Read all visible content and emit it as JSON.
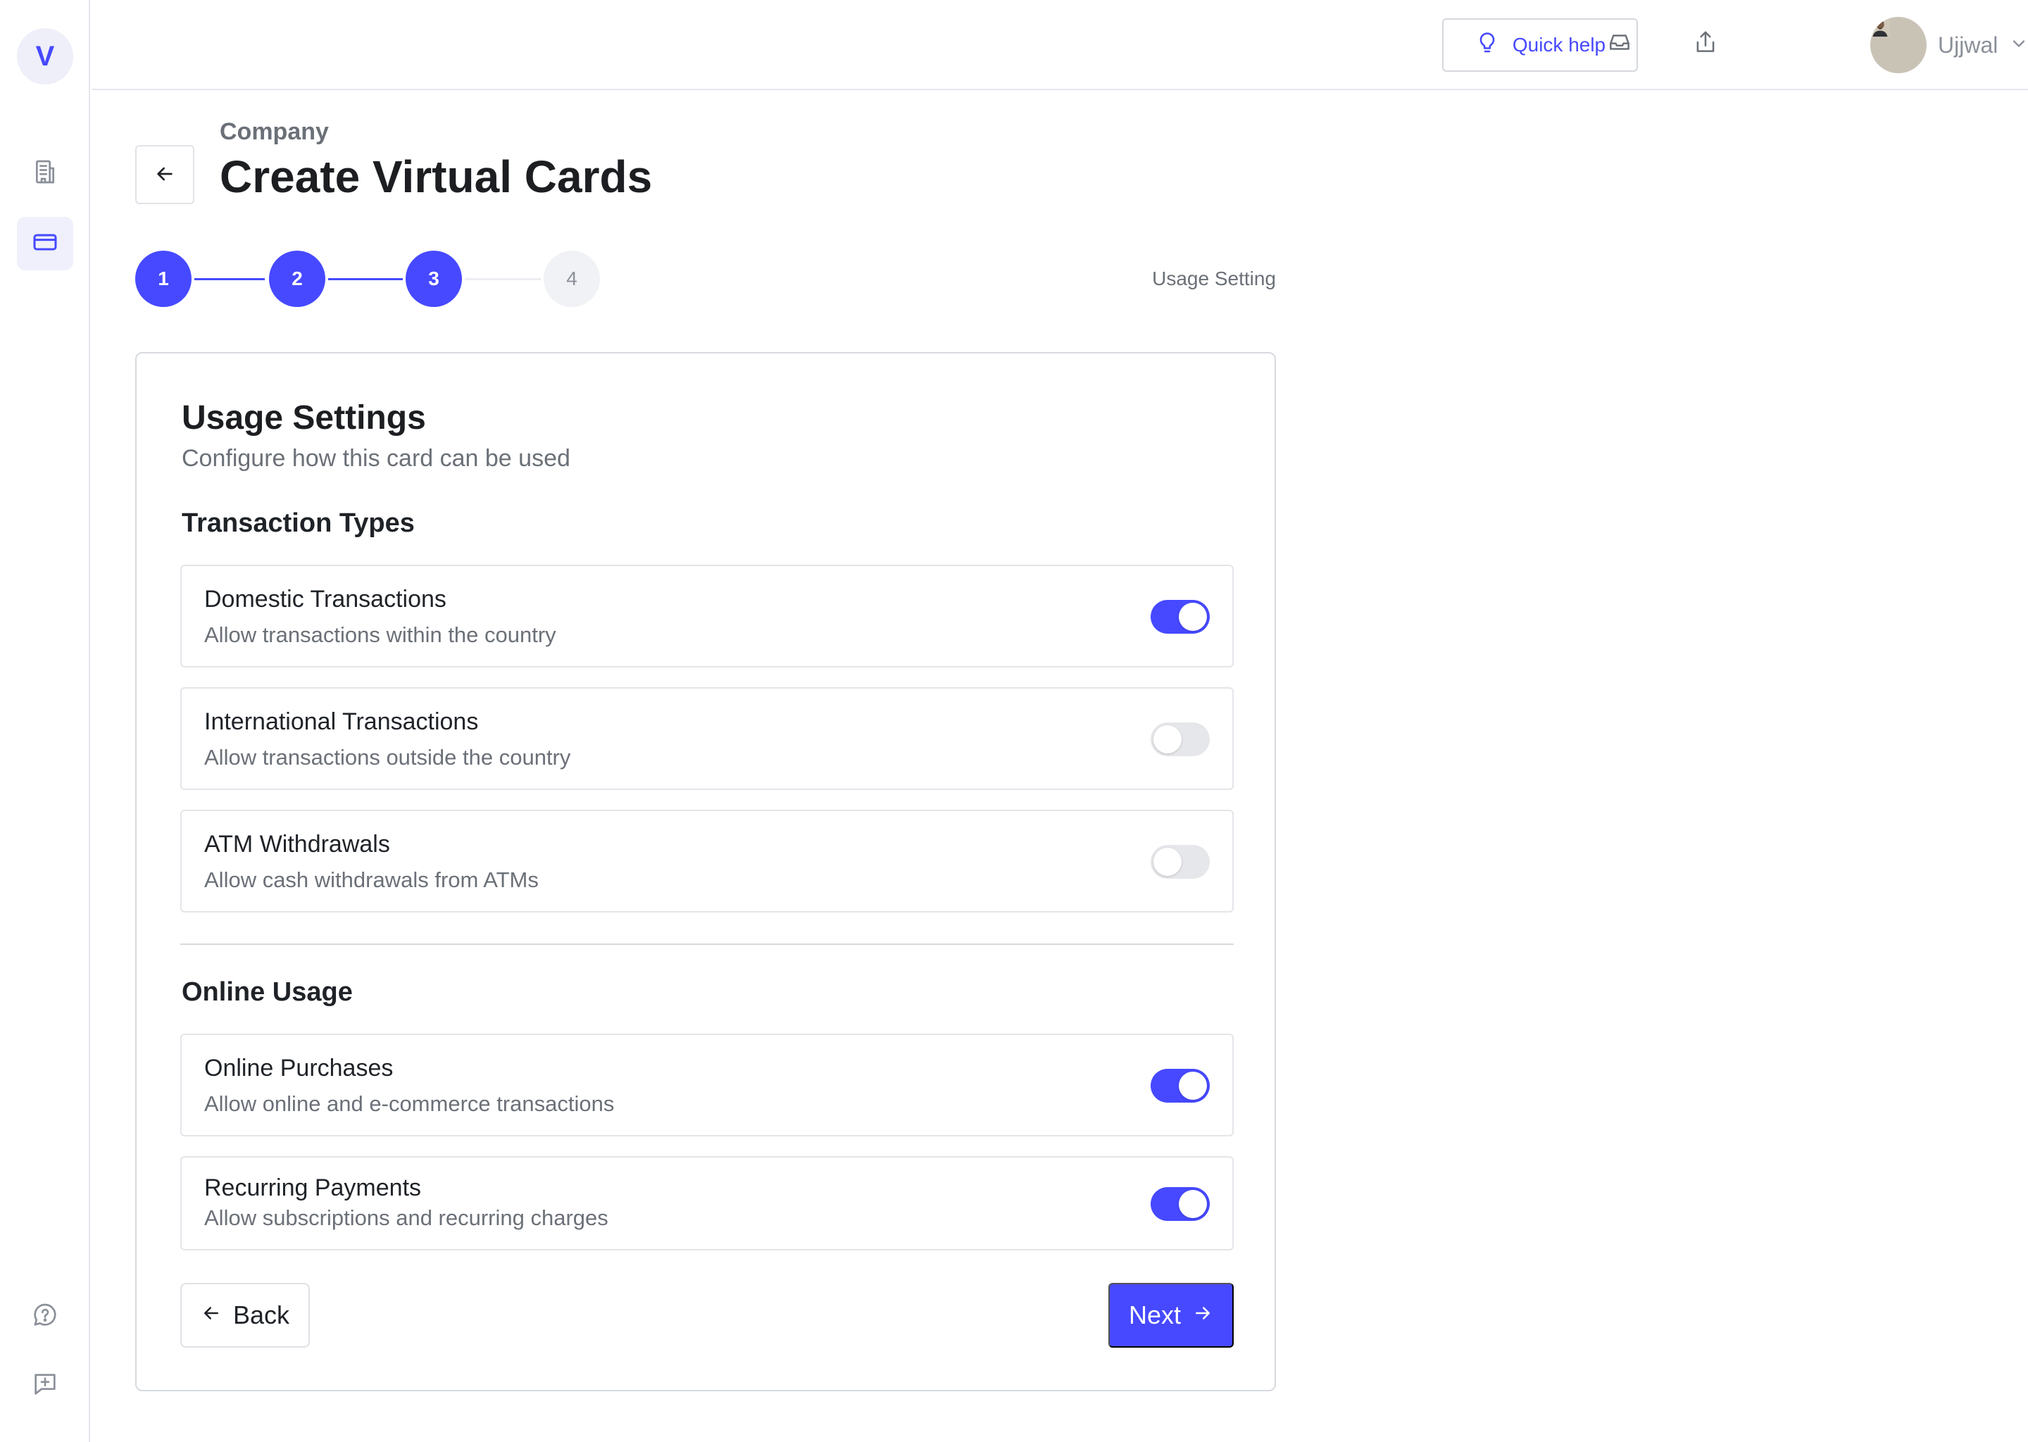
{
  "sidebar": {
    "logo_letter": "V",
    "icons": [
      "building-icon",
      "credit-card-icon",
      "help-chat-icon",
      "feedback-icon"
    ]
  },
  "topbar": {
    "quick_help_label": "Quick help",
    "user_name": "Ujjwal"
  },
  "header": {
    "breadcrumb": "Company",
    "title": "Create Virtual Cards"
  },
  "stepper": {
    "steps": [
      "1",
      "2",
      "3",
      "4"
    ],
    "completed_steps": 3,
    "current_label": "Usage Setting"
  },
  "card": {
    "title": "Usage Settings",
    "subtitle": "Configure how this card can be used",
    "sections": [
      {
        "heading": "Transaction Types",
        "options": [
          {
            "title": "Domestic Transactions",
            "description": "Allow transactions within the country",
            "enabled": true
          },
          {
            "title": "International Transactions",
            "description": "Allow transactions outside the country",
            "enabled": false
          },
          {
            "title": "ATM Withdrawals",
            "description": "Allow cash withdrawals from ATMs",
            "enabled": false
          }
        ]
      },
      {
        "heading": "Online Usage",
        "options": [
          {
            "title": "Online Purchases",
            "description": "Allow online and e-commerce transactions",
            "enabled": true
          },
          {
            "title": "Recurring Payments",
            "description": "Allow subscriptions and recurring charges",
            "enabled": true
          }
        ]
      }
    ],
    "back_label": "Back",
    "next_label": "Next"
  },
  "colors": {
    "accent": "#4649ff",
    "toggle_off": "#e6e7ea",
    "muted_text": "#6b7078"
  }
}
